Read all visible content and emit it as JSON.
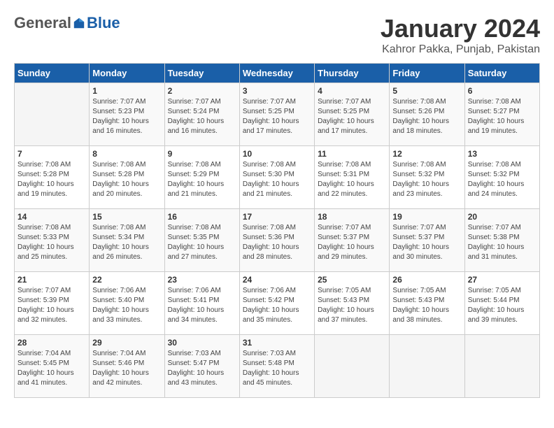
{
  "logo": {
    "general": "General",
    "blue": "Blue"
  },
  "title": "January 2024",
  "subtitle": "Kahror Pakka, Punjab, Pakistan",
  "days_of_week": [
    "Sunday",
    "Monday",
    "Tuesday",
    "Wednesday",
    "Thursday",
    "Friday",
    "Saturday"
  ],
  "weeks": [
    [
      {
        "day": "",
        "info": ""
      },
      {
        "day": "1",
        "info": "Sunrise: 7:07 AM\nSunset: 5:23 PM\nDaylight: 10 hours\nand 16 minutes."
      },
      {
        "day": "2",
        "info": "Sunrise: 7:07 AM\nSunset: 5:24 PM\nDaylight: 10 hours\nand 16 minutes."
      },
      {
        "day": "3",
        "info": "Sunrise: 7:07 AM\nSunset: 5:25 PM\nDaylight: 10 hours\nand 17 minutes."
      },
      {
        "day": "4",
        "info": "Sunrise: 7:07 AM\nSunset: 5:25 PM\nDaylight: 10 hours\nand 17 minutes."
      },
      {
        "day": "5",
        "info": "Sunrise: 7:08 AM\nSunset: 5:26 PM\nDaylight: 10 hours\nand 18 minutes."
      },
      {
        "day": "6",
        "info": "Sunrise: 7:08 AM\nSunset: 5:27 PM\nDaylight: 10 hours\nand 19 minutes."
      }
    ],
    [
      {
        "day": "7",
        "info": "Sunrise: 7:08 AM\nSunset: 5:28 PM\nDaylight: 10 hours\nand 19 minutes."
      },
      {
        "day": "8",
        "info": "Sunrise: 7:08 AM\nSunset: 5:28 PM\nDaylight: 10 hours\nand 20 minutes."
      },
      {
        "day": "9",
        "info": "Sunrise: 7:08 AM\nSunset: 5:29 PM\nDaylight: 10 hours\nand 21 minutes."
      },
      {
        "day": "10",
        "info": "Sunrise: 7:08 AM\nSunset: 5:30 PM\nDaylight: 10 hours\nand 21 minutes."
      },
      {
        "day": "11",
        "info": "Sunrise: 7:08 AM\nSunset: 5:31 PM\nDaylight: 10 hours\nand 22 minutes."
      },
      {
        "day": "12",
        "info": "Sunrise: 7:08 AM\nSunset: 5:32 PM\nDaylight: 10 hours\nand 23 minutes."
      },
      {
        "day": "13",
        "info": "Sunrise: 7:08 AM\nSunset: 5:32 PM\nDaylight: 10 hours\nand 24 minutes."
      }
    ],
    [
      {
        "day": "14",
        "info": "Sunrise: 7:08 AM\nSunset: 5:33 PM\nDaylight: 10 hours\nand 25 minutes."
      },
      {
        "day": "15",
        "info": "Sunrise: 7:08 AM\nSunset: 5:34 PM\nDaylight: 10 hours\nand 26 minutes."
      },
      {
        "day": "16",
        "info": "Sunrise: 7:08 AM\nSunset: 5:35 PM\nDaylight: 10 hours\nand 27 minutes."
      },
      {
        "day": "17",
        "info": "Sunrise: 7:08 AM\nSunset: 5:36 PM\nDaylight: 10 hours\nand 28 minutes."
      },
      {
        "day": "18",
        "info": "Sunrise: 7:07 AM\nSunset: 5:37 PM\nDaylight: 10 hours\nand 29 minutes."
      },
      {
        "day": "19",
        "info": "Sunrise: 7:07 AM\nSunset: 5:37 PM\nDaylight: 10 hours\nand 30 minutes."
      },
      {
        "day": "20",
        "info": "Sunrise: 7:07 AM\nSunset: 5:38 PM\nDaylight: 10 hours\nand 31 minutes."
      }
    ],
    [
      {
        "day": "21",
        "info": "Sunrise: 7:07 AM\nSunset: 5:39 PM\nDaylight: 10 hours\nand 32 minutes."
      },
      {
        "day": "22",
        "info": "Sunrise: 7:06 AM\nSunset: 5:40 PM\nDaylight: 10 hours\nand 33 minutes."
      },
      {
        "day": "23",
        "info": "Sunrise: 7:06 AM\nSunset: 5:41 PM\nDaylight: 10 hours\nand 34 minutes."
      },
      {
        "day": "24",
        "info": "Sunrise: 7:06 AM\nSunset: 5:42 PM\nDaylight: 10 hours\nand 35 minutes."
      },
      {
        "day": "25",
        "info": "Sunrise: 7:05 AM\nSunset: 5:43 PM\nDaylight: 10 hours\nand 37 minutes."
      },
      {
        "day": "26",
        "info": "Sunrise: 7:05 AM\nSunset: 5:43 PM\nDaylight: 10 hours\nand 38 minutes."
      },
      {
        "day": "27",
        "info": "Sunrise: 7:05 AM\nSunset: 5:44 PM\nDaylight: 10 hours\nand 39 minutes."
      }
    ],
    [
      {
        "day": "28",
        "info": "Sunrise: 7:04 AM\nSunset: 5:45 PM\nDaylight: 10 hours\nand 41 minutes."
      },
      {
        "day": "29",
        "info": "Sunrise: 7:04 AM\nSunset: 5:46 PM\nDaylight: 10 hours\nand 42 minutes."
      },
      {
        "day": "30",
        "info": "Sunrise: 7:03 AM\nSunset: 5:47 PM\nDaylight: 10 hours\nand 43 minutes."
      },
      {
        "day": "31",
        "info": "Sunrise: 7:03 AM\nSunset: 5:48 PM\nDaylight: 10 hours\nand 45 minutes."
      },
      {
        "day": "",
        "info": ""
      },
      {
        "day": "",
        "info": ""
      },
      {
        "day": "",
        "info": ""
      }
    ]
  ]
}
